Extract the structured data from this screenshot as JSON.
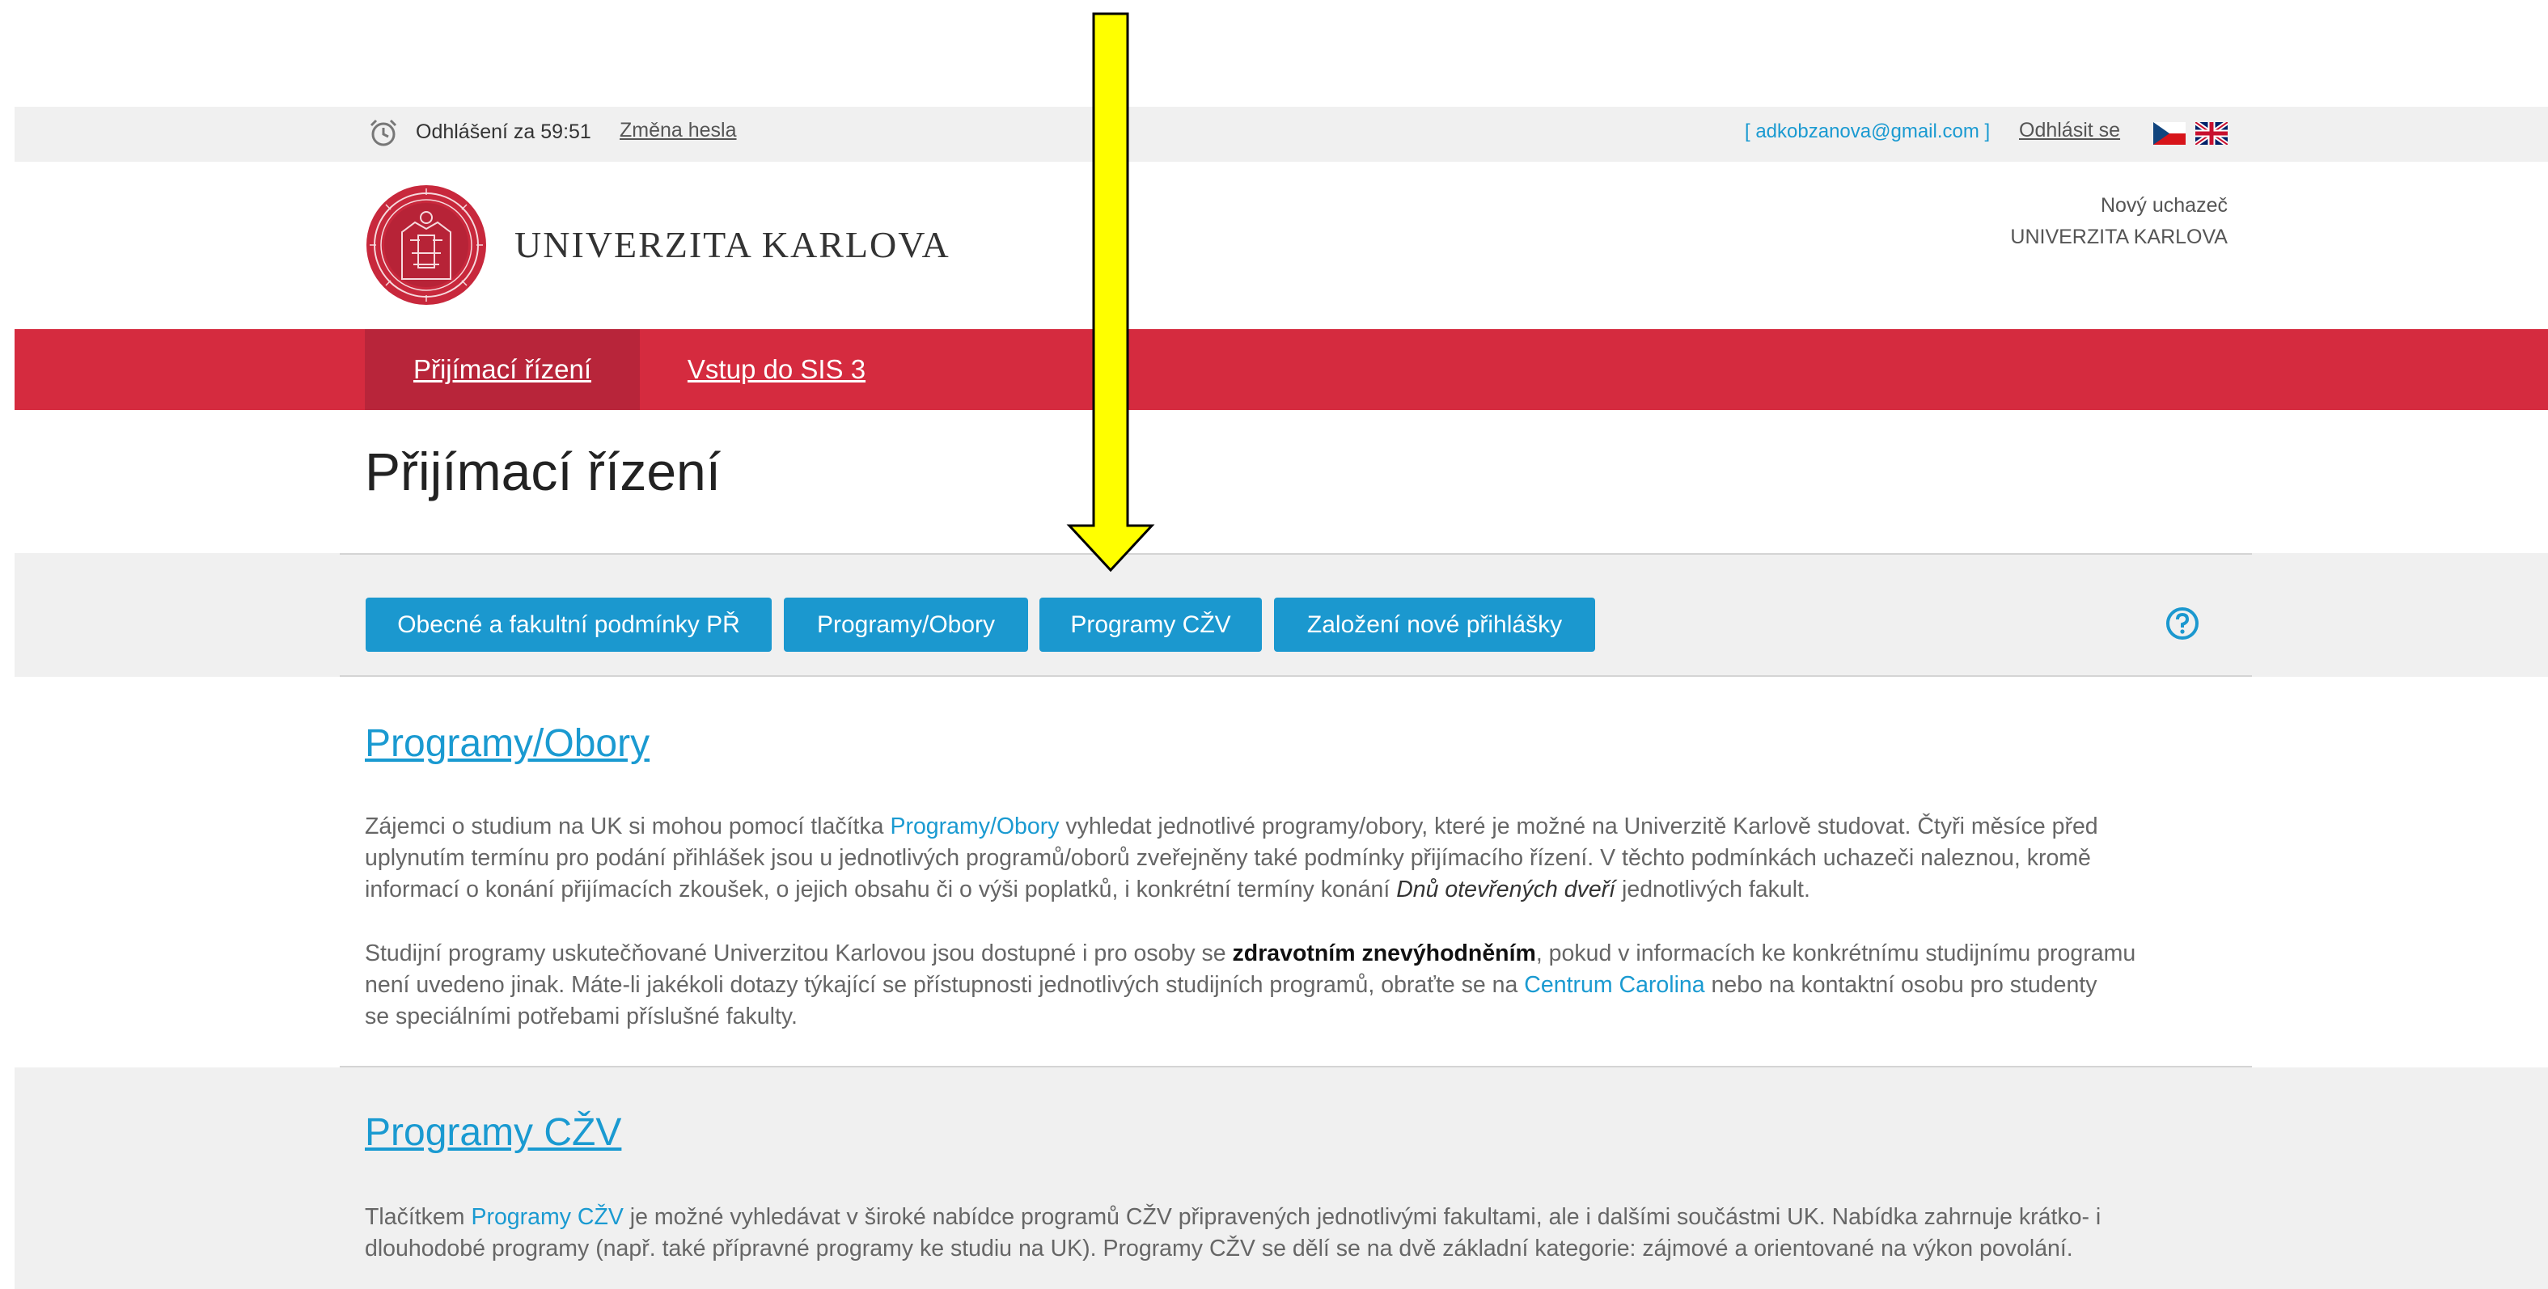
{
  "topbar": {
    "logout_timer": "Odhlášení za 59:51",
    "change_password": "Změna hesla",
    "user_email": "[ adkobzanova@gmail.com ]",
    "logout": "Odhlásit se",
    "icons": [
      "alarm-clock-icon",
      "czech-flag-icon",
      "uk-flag-icon"
    ]
  },
  "header": {
    "wordmark": "UNIVERZITA KARLOVA",
    "user_role": "Nový uchazeč",
    "user_university": "UNIVERZITA KARLOVA"
  },
  "nav": {
    "items": [
      {
        "label": "Přijímací řízení",
        "active": true
      },
      {
        "label": "Vstup do SIS 3",
        "active": false
      }
    ]
  },
  "page": {
    "title": "Přijímací řízení"
  },
  "toolbar": {
    "buttons": [
      {
        "label": "Obecné a fakultní podmínky PŘ"
      },
      {
        "label": "Programy/Obory"
      },
      {
        "label": "Programy CŽV"
      },
      {
        "label": "Založení nové přihlášky"
      }
    ],
    "help_icon": "question-circle-icon"
  },
  "sections": {
    "programs": {
      "heading": "Programy/Obory",
      "p1_l1_a": "Zájemci o studium na UK si mohou pomocí tlačítka ",
      "p1_l1_link": "Programy/Obory",
      "p1_l1_b": " vyhledat jednotlivé programy/obory, které je možné na Univerzitě Karlově studovat. Čtyři měsíce před",
      "p1_l2": "uplynutím termínu pro podání přihlášek jsou u jednotlivých programů/oborů zveřejněny také podmínky přijímacího řízení. V těchto podmínkách uchazeči naleznou, kromě",
      "p1_l3_a": "informací o konání přijímacích zkoušek, o jejich obsahu či o výši poplatků, i konkrétní termíny konání ",
      "p1_l3_em": "Dnů otevřených dveří",
      "p1_l3_b": " jednotlivých fakult.",
      "p2_l1_a": "Studijní programy uskutečňované Univerzitou Karlovou jsou dostupné i pro osoby se ",
      "p2_l1_strong": "zdravotním znevýhodněním",
      "p2_l1_b": ", pokud v informacích ke konkrétnímu studijnímu programu",
      "p2_l2_a": "není uvedeno jinak. Máte-li jakékoli dotazy týkající se přístupnosti jednotlivých studijních programů, obraťte se na ",
      "p2_l2_link": "Centrum Carolina",
      "p2_l2_b": " nebo na kontaktní osobu pro studenty",
      "p2_l3": "se speciálními potřebami příslušné fakulty."
    },
    "czv": {
      "heading": "Programy CŽV",
      "l1_a": "Tlačítkem ",
      "l1_link": "Programy CŽV",
      "l1_b": " je možné vyhledávat v široké nabídce programů CŽV připravených jednotlivými fakultami, ale i dalšími součástmi UK. Nabídka zahrnuje krátko- i",
      "l2": "dlouhodobé programy (např. také přípravné programy ke studiu na UK). Programy CŽV se dělí se na dvě základní kategorie: zájmové a orientované na výkon povolání."
    }
  },
  "colors": {
    "brand_red": "#d52b3f",
    "brand_red_active": "#b8253a",
    "accent_blue": "#1b98cf",
    "annotation_yellow": "#ffff00"
  },
  "annotation": "down-arrow-icon"
}
